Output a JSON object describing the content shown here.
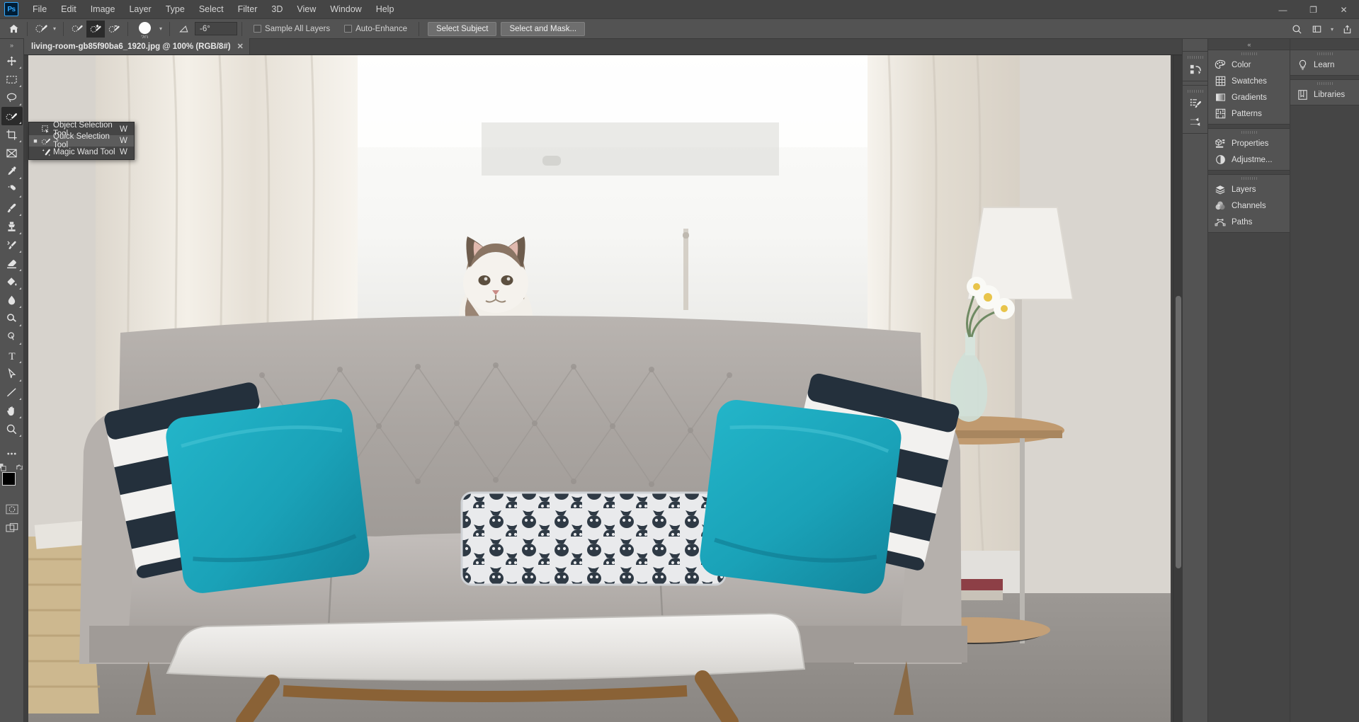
{
  "app": {
    "logo_text": "Ps",
    "name": "Adobe Photoshop"
  },
  "menubar": {
    "items": [
      {
        "label": "File"
      },
      {
        "label": "Edit"
      },
      {
        "label": "Image"
      },
      {
        "label": "Layer"
      },
      {
        "label": "Type"
      },
      {
        "label": "Select"
      },
      {
        "label": "Filter"
      },
      {
        "label": "3D"
      },
      {
        "label": "View"
      },
      {
        "label": "Window"
      },
      {
        "label": "Help"
      }
    ],
    "window_controls": [
      {
        "name": "minimize",
        "glyph": "—"
      },
      {
        "name": "restore",
        "glyph": "❐"
      },
      {
        "name": "close",
        "glyph": "✕"
      }
    ]
  },
  "options_bar": {
    "home_icon": "home-icon",
    "tool_preset_icon": "quick-selection-brush-icon",
    "tool_preset_caret": "▾",
    "modes": [
      {
        "name": "new-selection",
        "icon": "selection-brush-new-icon",
        "active": false
      },
      {
        "name": "add-to-selection",
        "icon": "selection-brush-add-icon",
        "active": true
      },
      {
        "name": "subtract-from-selection",
        "icon": "selection-brush-subtract-icon",
        "active": false
      }
    ],
    "brush_size": "20",
    "brush_caret": "▾",
    "angle_icon": "angle-icon",
    "angle_value": "-6°",
    "checkboxes": [
      {
        "label": "Sample All Layers",
        "checked": false
      },
      {
        "label": "Auto-Enhance",
        "checked": false
      }
    ],
    "buttons": [
      {
        "label": "Select Subject"
      },
      {
        "label": "Select and Mask..."
      }
    ],
    "right_icons": [
      {
        "name": "search-icon",
        "glyph": "⚲"
      },
      {
        "name": "workspace-icon",
        "glyph": "▤"
      },
      {
        "name": "chevron-down-icon",
        "glyph": "▾"
      },
      {
        "name": "share-icon",
        "glyph": "↑"
      }
    ]
  },
  "toolbar": {
    "collapse_glyph": "»",
    "tools": [
      {
        "name": "move-tool",
        "icon": "move-icon",
        "has_flyout": true,
        "active": false
      },
      {
        "name": "rectangular-marquee-tool",
        "icon": "marquee-icon",
        "has_flyout": true,
        "active": false
      },
      {
        "name": "lasso-tool",
        "icon": "lasso-icon",
        "has_flyout": true,
        "active": false
      },
      {
        "name": "quick-selection-tool",
        "icon": "quick-selection-icon",
        "has_flyout": true,
        "active": true
      },
      {
        "name": "crop-tool",
        "icon": "crop-icon",
        "has_flyout": true,
        "active": false
      },
      {
        "name": "frame-tool",
        "icon": "frame-icon",
        "has_flyout": false,
        "active": false
      },
      {
        "name": "eyedropper-tool",
        "icon": "eyedropper-icon",
        "has_flyout": true,
        "active": false
      },
      {
        "name": "spot-healing-brush-tool",
        "icon": "healing-brush-icon",
        "has_flyout": true,
        "active": false
      },
      {
        "name": "brush-tool",
        "icon": "brush-icon",
        "has_flyout": true,
        "active": false
      },
      {
        "name": "clone-stamp-tool",
        "icon": "clone-stamp-icon",
        "has_flyout": true,
        "active": false
      },
      {
        "name": "history-brush-tool",
        "icon": "history-brush-icon",
        "has_flyout": true,
        "active": false
      },
      {
        "name": "eraser-tool",
        "icon": "eraser-icon",
        "has_flyout": true,
        "active": false
      },
      {
        "name": "gradient-tool",
        "icon": "paint-bucket-icon",
        "has_flyout": true,
        "active": false
      },
      {
        "name": "blur-tool",
        "icon": "blur-drop-icon",
        "has_flyout": true,
        "active": false
      },
      {
        "name": "dodge-tool",
        "icon": "dodge-icon",
        "has_flyout": true,
        "active": false
      },
      {
        "name": "pen-tool",
        "icon": "pen-icon",
        "has_flyout": true,
        "active": false
      },
      {
        "name": "horizontal-type-tool",
        "icon": "type-t-icon",
        "has_flyout": true,
        "active": false
      },
      {
        "name": "path-selection-tool",
        "icon": "path-arrow-icon",
        "has_flyout": true,
        "active": false
      },
      {
        "name": "line-tool",
        "icon": "line-shape-icon",
        "has_flyout": true,
        "active": false
      },
      {
        "name": "hand-tool",
        "icon": "hand-icon",
        "has_flyout": true,
        "active": false
      },
      {
        "name": "zoom-tool",
        "icon": "magnifier-icon",
        "has_flyout": false,
        "active": false
      },
      {
        "name": "edit-toolbar",
        "icon": "ellipsis-icon",
        "has_flyout": false,
        "active": false
      }
    ],
    "color": {
      "foreground": "#000000",
      "background": "#ffffff",
      "swap_icon": "swap-arrows-icon",
      "default_icon": "default-colors-icon"
    },
    "mask_mode_icon": "quick-mask-icon",
    "screen_mode_icon": "screen-mode-icon"
  },
  "tool_flyout": {
    "items": [
      {
        "label": "Object Selection Tool",
        "shortcut": "W",
        "icon": "object-selection-icon",
        "selected": false
      },
      {
        "label": "Quick Selection Tool",
        "shortcut": "W",
        "icon": "quick-selection-icon",
        "selected": true
      },
      {
        "label": "Magic Wand Tool",
        "shortcut": "W",
        "icon": "magic-wand-icon",
        "selected": false
      }
    ]
  },
  "document": {
    "tab_title": "living-room-gb85f90ba6_1920.jpg @ 100% (RGB/8#)",
    "close_glyph": "✕",
    "zoom_level": "100%",
    "color_mode": "RGB/8#",
    "filename": "living-room-gb85f90ba6_1920.jpg",
    "image_description": "Living room with grey tufted sofa, teal and striped pillows, a cat sitting on the windowsill, white marble coffee table, side table with daisies"
  },
  "right_rail_icons": {
    "collapse_glyph": "«",
    "groups": [
      {
        "items": [
          {
            "name": "history-panel-icon"
          }
        ]
      },
      {
        "items": [
          {
            "name": "brush-settings-icon"
          },
          {
            "name": "brushes-panel-icon"
          }
        ]
      }
    ]
  },
  "panels": {
    "collapse_glyph": "«",
    "column_left": [
      {
        "items": [
          {
            "label": "Color",
            "icon": "color-palette-icon"
          },
          {
            "label": "Swatches",
            "icon": "swatches-grid-icon"
          },
          {
            "label": "Gradients",
            "icon": "gradient-icon"
          },
          {
            "label": "Patterns",
            "icon": "patterns-icon"
          }
        ]
      },
      {
        "items": [
          {
            "label": "Properties",
            "icon": "properties-icon"
          },
          {
            "label": "Adjustme...",
            "icon": "adjustments-icon"
          }
        ]
      },
      {
        "items": [
          {
            "label": "Layers",
            "icon": "layers-icon"
          },
          {
            "label": "Channels",
            "icon": "channels-icon"
          },
          {
            "label": "Paths",
            "icon": "paths-icon"
          }
        ]
      }
    ],
    "column_right": [
      {
        "items": [
          {
            "label": "Learn",
            "icon": "lightbulb-icon"
          }
        ]
      },
      {
        "items": [
          {
            "label": "Libraries",
            "icon": "libraries-book-icon"
          }
        ]
      }
    ]
  },
  "colors": {
    "menu_bg": "#454545",
    "panel_bg": "#535353",
    "canvas_bg": "#3f3f3f",
    "accent": "#31a8ff",
    "text": "#d4d4d4"
  }
}
